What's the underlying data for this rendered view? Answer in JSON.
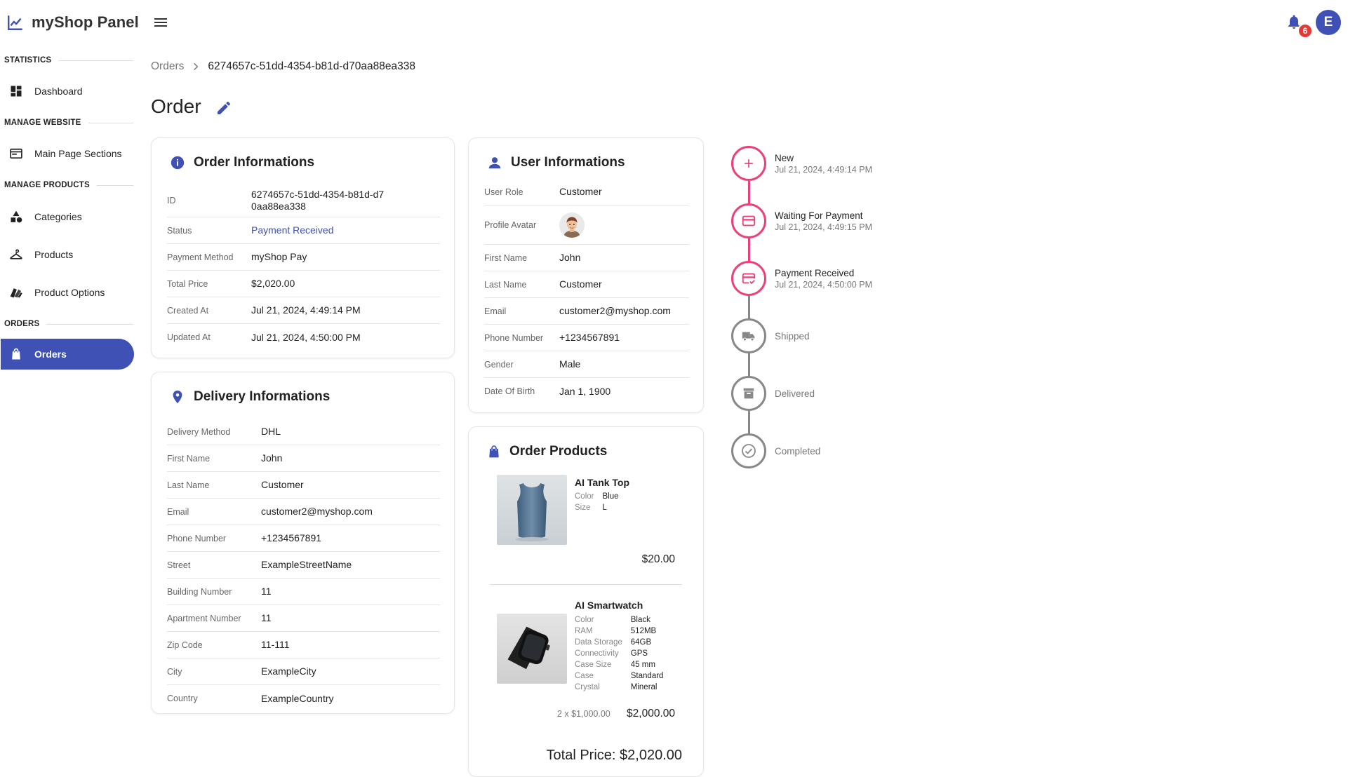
{
  "app": {
    "title": "myShop Panel"
  },
  "header": {
    "notification_count": "6",
    "user_initial": "E"
  },
  "sidebar": {
    "sections": [
      {
        "label": "STATISTICS"
      },
      {
        "label": "MANAGE WEBSITE"
      },
      {
        "label": "MANAGE PRODUCTS"
      },
      {
        "label": "ORDERS"
      }
    ],
    "items": [
      {
        "label": "Dashboard",
        "icon": "dashboard-icon"
      },
      {
        "label": "Main Page Sections",
        "icon": "web-sections-icon"
      },
      {
        "label": "Categories",
        "icon": "category-icon"
      },
      {
        "label": "Products",
        "icon": "hanger-icon"
      },
      {
        "label": "Product Options",
        "icon": "options-icon"
      },
      {
        "label": "Orders",
        "icon": "shopping-bag-icon",
        "active": true
      }
    ]
  },
  "breadcrumb": {
    "parent": "Orders",
    "current": "6274657c-51dd-4354-b81d-d70aa88ea338"
  },
  "page": {
    "title": "Order"
  },
  "order_info": {
    "title": "Order Informations",
    "rows": [
      {
        "key": "ID",
        "value": "6274657c-51dd-4354-b81d-d70aa88ea338"
      },
      {
        "key": "Status",
        "value": "Payment Received"
      },
      {
        "key": "Payment Method",
        "value": "myShop Pay"
      },
      {
        "key": "Total Price",
        "value": "$2,020.00"
      },
      {
        "key": "Created At",
        "value": "Jul 21, 2024, 4:49:14 PM"
      },
      {
        "key": "Updated At",
        "value": "Jul 21, 2024, 4:50:00 PM"
      }
    ]
  },
  "delivery_info": {
    "title": "Delivery Informations",
    "rows": [
      {
        "key": "Delivery Method",
        "value": "DHL"
      },
      {
        "key": "First Name",
        "value": "John"
      },
      {
        "key": "Last Name",
        "value": "Customer"
      },
      {
        "key": "Email",
        "value": "customer2@myshop.com"
      },
      {
        "key": "Phone Number",
        "value": "+1234567891"
      },
      {
        "key": "Street",
        "value": "ExampleStreetName"
      },
      {
        "key": "Building Number",
        "value": "11"
      },
      {
        "key": "Apartment Number",
        "value": "11"
      },
      {
        "key": "Zip Code",
        "value": "11-111"
      },
      {
        "key": "City",
        "value": "ExampleCity"
      },
      {
        "key": "Country",
        "value": "ExampleCountry"
      }
    ]
  },
  "user_info": {
    "title": "User Informations",
    "rows": [
      {
        "key": "User Role",
        "value": "Customer"
      },
      {
        "key": "Profile Avatar",
        "value": ""
      },
      {
        "key": "First Name",
        "value": "John"
      },
      {
        "key": "Last Name",
        "value": "Customer"
      },
      {
        "key": "Email",
        "value": "customer2@myshop.com"
      },
      {
        "key": "Phone Number",
        "value": "+1234567891"
      },
      {
        "key": "Gender",
        "value": "Male"
      },
      {
        "key": "Date Of Birth",
        "value": "Jan 1, 1900"
      }
    ]
  },
  "order_products": {
    "title": "Order Products",
    "items": [
      {
        "name": "AI Tank Top",
        "attributes": [
          {
            "key": "Color",
            "value": "Blue"
          },
          {
            "key": "Size",
            "value": "L"
          }
        ],
        "price": "$20.00"
      },
      {
        "name": "AI Smartwatch",
        "attributes": [
          {
            "key": "Color",
            "value": "Black"
          },
          {
            "key": "RAM",
            "value": "512MB"
          },
          {
            "key": "Data Storage",
            "value": "64GB"
          },
          {
            "key": "Connectivity",
            "value": "GPS"
          },
          {
            "key": "Case Size",
            "value": "45 mm"
          },
          {
            "key": "Case",
            "value": "Standard"
          },
          {
            "key": "Crystal",
            "value": "Mineral"
          }
        ],
        "quantity_text": "2 x $1,000.00",
        "price": "$2,000.00"
      }
    ],
    "total": "Total Price: $2,020.00"
  },
  "timeline": {
    "steps": [
      {
        "label": "New",
        "date": "Jul 21, 2024, 4:49:14 PM",
        "done": true,
        "icon": "plus-icon"
      },
      {
        "label": "Waiting For Payment",
        "date": "Jul 21, 2024, 4:49:15 PM",
        "done": true,
        "icon": "credit-card-icon"
      },
      {
        "label": "Payment Received",
        "date": "Jul 21, 2024, 4:50:00 PM",
        "done": true,
        "icon": "card-check-icon"
      },
      {
        "label": "Shipped",
        "date": "",
        "done": false,
        "icon": "truck-icon"
      },
      {
        "label": "Delivered",
        "date": "",
        "done": false,
        "icon": "archive-box-icon"
      },
      {
        "label": "Completed",
        "date": "",
        "done": false,
        "icon": "check-circle-icon"
      }
    ]
  },
  "colors": {
    "primary": "#3f51b5",
    "timeline_done": "#ec407a",
    "timeline_todo": "#888888",
    "badge": "#e53935"
  }
}
